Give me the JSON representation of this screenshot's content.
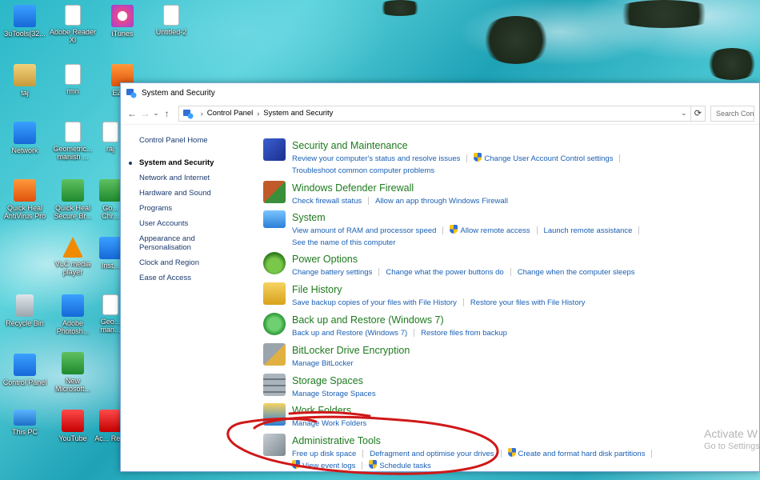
{
  "desktop": {
    "icons": [
      {
        "label": "3uTools(32...",
        "icon": "3utools-icon"
      },
      {
        "label": "taj",
        "icon": "user-folder-icon"
      },
      {
        "label": "Network",
        "icon": "network-icon"
      },
      {
        "label": "Quick Heal AntiVirus Pro",
        "icon": "quick-heal-icon"
      },
      {
        "label": "Recycle Bin",
        "icon": "recycle-bin-icon"
      },
      {
        "label": "Control Panel",
        "icon": "control-panel-icon"
      },
      {
        "label": "This PC",
        "icon": "this-pc-icon"
      },
      {
        "label": "Adobe Reader XI",
        "icon": "adobe-reader-icon"
      },
      {
        "label": "rmn",
        "icon": "file-icon"
      },
      {
        "label": "Geometric... manish ...",
        "icon": "file-icon"
      },
      {
        "label": "Quick Heal Secure Br...",
        "icon": "browser-icon"
      },
      {
        "label": "VLC media player",
        "icon": "vlc-icon"
      },
      {
        "label": "Adobe Photosh...",
        "icon": "photoshop-icon"
      },
      {
        "label": "New Microsoft...",
        "icon": "excel-icon"
      },
      {
        "label": "YouTube",
        "icon": "youtube-icon"
      },
      {
        "label": "iTunes",
        "icon": "itunes-icon"
      },
      {
        "label": "Untitled-2",
        "icon": "file-icon"
      },
      {
        "label": "EZC...",
        "icon": "app-icon"
      },
      {
        "label": "raj",
        "icon": "file-icon"
      },
      {
        "label": "Go... Chr...",
        "icon": "chrome-icon"
      },
      {
        "label": "Inst...",
        "icon": "app-icon"
      },
      {
        "label": "Geo... man...",
        "icon": "file-icon"
      },
      {
        "label": "Ac... Re...",
        "icon": "app-icon"
      }
    ]
  },
  "window": {
    "title": "System and Security",
    "nav": {
      "back": "←",
      "forward": "→",
      "dropdown": "⌄",
      "up": "↑",
      "refresh": "⟳"
    },
    "breadcrumb": [
      "Control Panel",
      "System and Security"
    ],
    "search_placeholder": "Search Cont",
    "sidebar": {
      "home": "Control Panel Home",
      "items": [
        "System and Security",
        "Network and Internet",
        "Hardware and Sound",
        "Programs",
        "User Accounts",
        "Appearance and Personalisation",
        "Clock and Region",
        "Ease of Access"
      ]
    },
    "categories": [
      {
        "title": "Security and Maintenance",
        "icon": "flag-icon",
        "links": [
          "Review your computer's status and resolve issues",
          "Change User Account Control settings",
          "Troubleshoot common computer problems"
        ]
      },
      {
        "title": "Windows Defender Firewall",
        "icon": "firewall-icon",
        "links": [
          "Check firewall status",
          "Allow an app through Windows Firewall"
        ]
      },
      {
        "title": "System",
        "icon": "monitor-icon",
        "links": [
          "View amount of RAM and processor speed",
          "Allow remote access",
          "Launch remote assistance",
          "See the name of this computer"
        ]
      },
      {
        "title": "Power Options",
        "icon": "power-icon",
        "links": [
          "Change battery settings",
          "Change what the power buttons do",
          "Change when the computer sleeps"
        ]
      },
      {
        "title": "File History",
        "icon": "file-history-icon",
        "links": [
          "Save backup copies of your files with File History",
          "Restore your files with File History"
        ]
      },
      {
        "title": "Back up and Restore (Windows 7)",
        "icon": "backup-icon",
        "links": [
          "Back up and Restore (Windows 7)",
          "Restore files from backup"
        ]
      },
      {
        "title": "BitLocker Drive Encryption",
        "icon": "bitlocker-icon",
        "links": [
          "Manage BitLocker"
        ]
      },
      {
        "title": "Storage Spaces",
        "icon": "storage-icon",
        "links": [
          "Manage Storage Spaces"
        ]
      },
      {
        "title": "Work Folders",
        "icon": "work-folders-icon",
        "links": [
          "Manage Work Folders"
        ]
      },
      {
        "title": "Administrative Tools",
        "icon": "admin-tools-icon",
        "links": [
          "Free up disk space",
          "Defragment and optimise your drives",
          "Create and format hard disk partitions",
          "View event logs",
          "Schedule tasks"
        ]
      }
    ]
  },
  "watermark": {
    "line1": "Activate W",
    "line2": "Go to Settings"
  },
  "annotation_color": "#d01818"
}
